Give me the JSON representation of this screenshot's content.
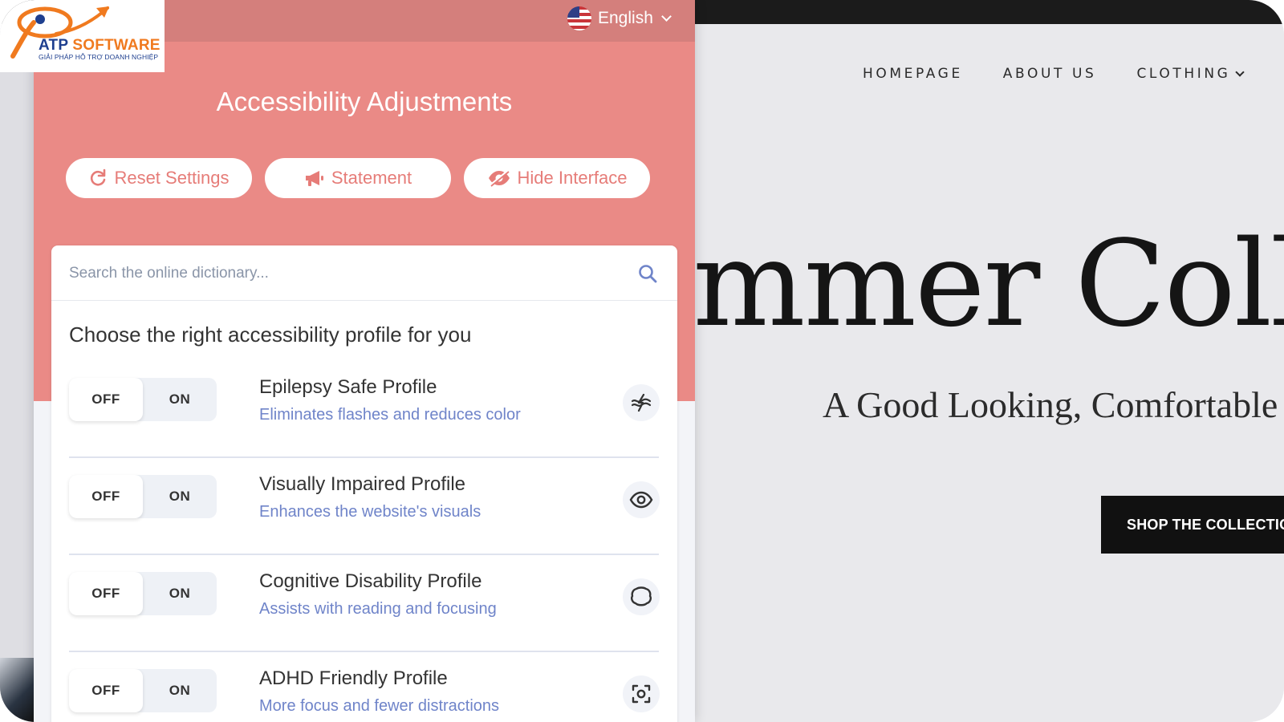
{
  "logo": {
    "brand_a": "ATP",
    "brand_b": "SOFTWARE",
    "tagline": "GIẢI PHÁP HỖ TRỢ DOANH NGHIỆP"
  },
  "site": {
    "nav": {
      "homepage": "HOMEPAGE",
      "about": "ABOUT US",
      "clothing": "CLOTHING"
    },
    "hero_title": "ummer Colle",
    "hero_subtitle": "A Good Looking, Comfortable T",
    "cta": "SHOP THE COLLECTIO"
  },
  "panel": {
    "language": "English",
    "title": "Accessibility Adjustments",
    "buttons": {
      "reset": "Reset Settings",
      "statement": "Statement",
      "hide": "Hide Interface"
    },
    "search_placeholder": "Search the online dictionary...",
    "choose_heading": "Choose the right accessibility profile for you",
    "toggle_off": "OFF",
    "toggle_on": "ON",
    "profiles": [
      {
        "name": "Epilepsy Safe Profile",
        "description": "Eliminates flashes and reduces color",
        "icon": "lightning-wave-icon"
      },
      {
        "name": "Visually Impaired Profile",
        "description": "Enhances the website's visuals",
        "icon": "eye-icon"
      },
      {
        "name": "Cognitive Disability Profile",
        "description": "Assists with reading and focusing",
        "icon": "brain-outline-icon"
      },
      {
        "name": "ADHD Friendly Profile",
        "description": "More focus and fewer distractions",
        "icon": "focus-target-icon"
      }
    ]
  },
  "colors": {
    "panel_header": "#ea8a86",
    "accent_text": "#e67c78",
    "desc_text": "#6f84c9",
    "logo_blue": "#1e3f8f",
    "logo_orange": "#f07a1f"
  }
}
